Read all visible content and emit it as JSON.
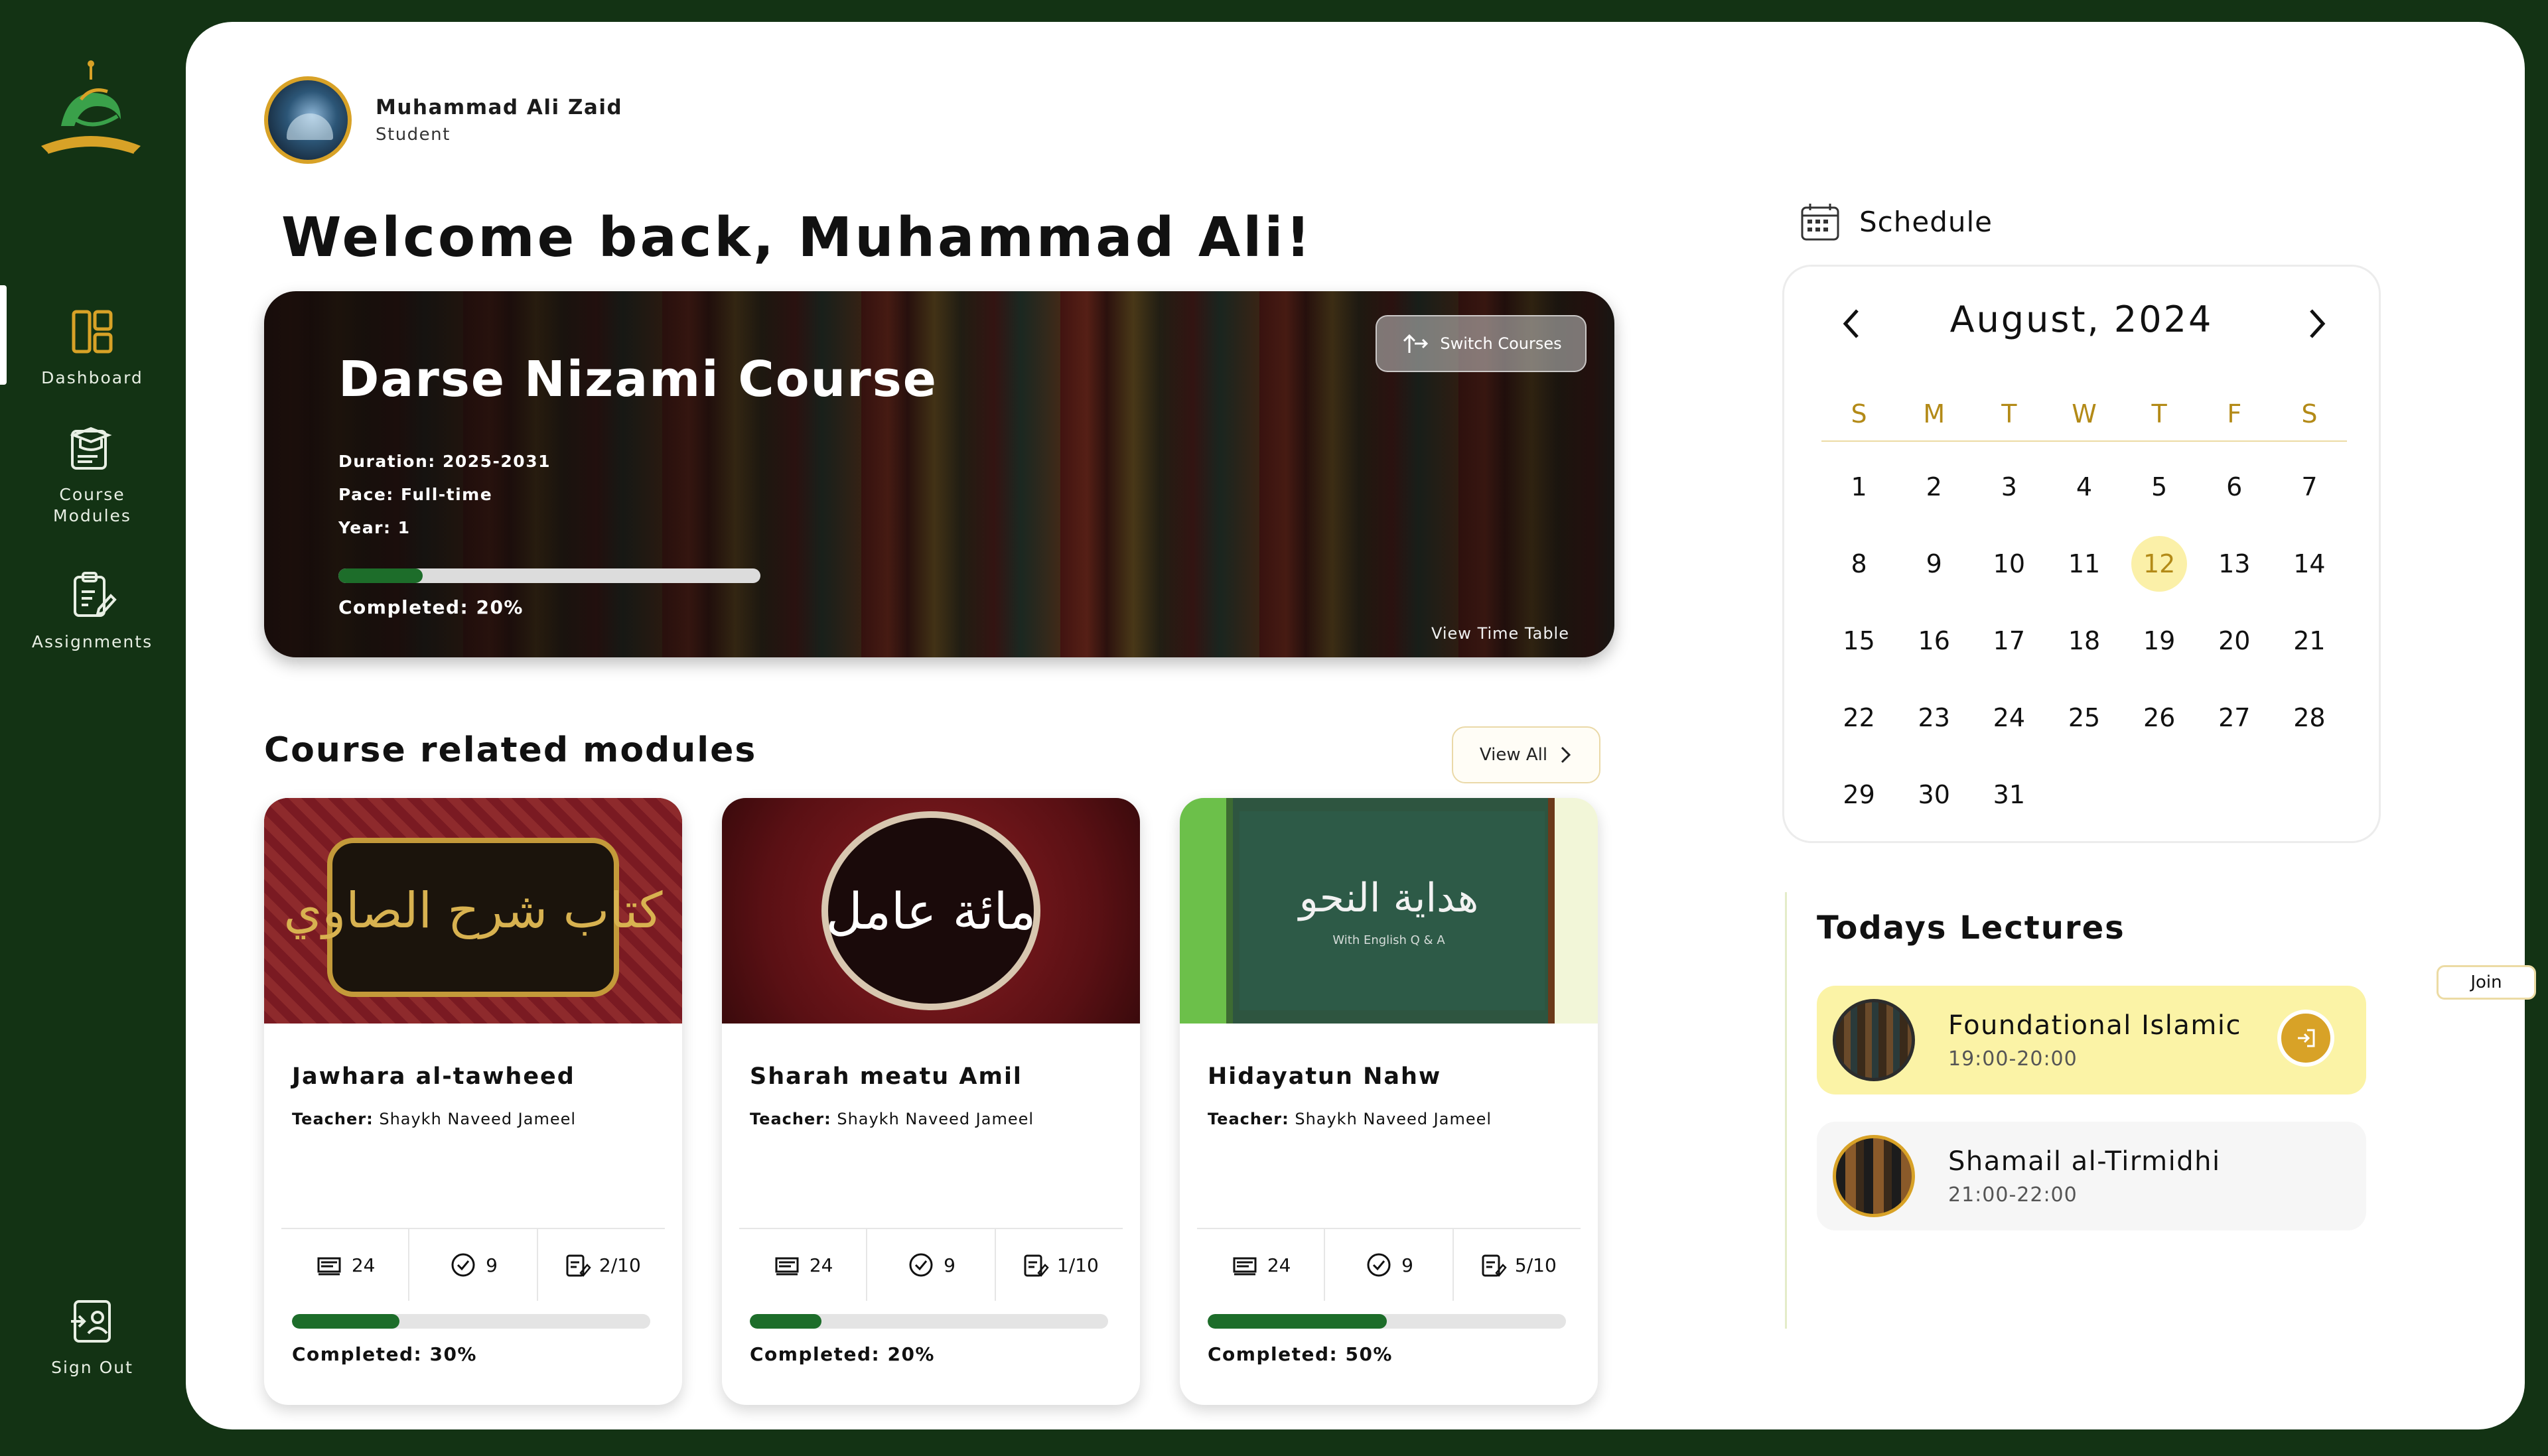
{
  "sidebar": {
    "items": [
      {
        "label": "Dashboard",
        "icon": "dashboard-icon"
      },
      {
        "label": "Course Modules",
        "icon": "course-modules-icon"
      },
      {
        "label": "Assignments",
        "icon": "assignments-icon"
      },
      {
        "label": "Sign Out",
        "icon": "sign-out-icon"
      }
    ]
  },
  "user": {
    "name": "Muhammad Ali Zaid",
    "role": "Student"
  },
  "welcome": "Welcome back, Muhammad Ali!",
  "hero": {
    "title": "Darse Nizami Course",
    "duration": "Duration: 2025-2031",
    "pace": "Pace: Full-time",
    "year": "Year: 1",
    "progress_percent": 20,
    "completed": "Completed: 20%",
    "switch_label": "Switch Courses",
    "timetable_label": "View Time Table"
  },
  "modules": {
    "title": "Course related modules",
    "view_all": "View All",
    "cards": [
      {
        "title": "Jawhara al-tawheed",
        "teacher_label": "Teacher:",
        "teacher": "Shaykh Naveed Jameel",
        "stat1": "24",
        "stat2": "9",
        "stat3": "2/10",
        "progress_percent": 30,
        "completed": "Completed: 30%"
      },
      {
        "title": "Sharah meatu Amil",
        "teacher_label": "Teacher:",
        "teacher": "Shaykh Naveed Jameel",
        "stat1": "24",
        "stat2": "9",
        "stat3": "1/10",
        "progress_percent": 20,
        "completed": "Completed: 20%"
      },
      {
        "title": "Hidayatun Nahw",
        "teacher_label": "Teacher:",
        "teacher": "Shaykh Naveed Jameel",
        "stat1": "24",
        "stat2": "9",
        "stat3": "5/10",
        "progress_percent": 50,
        "completed": "Completed: 50%"
      }
    ]
  },
  "schedule": {
    "title": "Schedule",
    "month": "August, 2024",
    "weekdays": [
      "S",
      "M",
      "T",
      "W",
      "T",
      "F",
      "S"
    ],
    "days": [
      "1",
      "2",
      "3",
      "4",
      "5",
      "6",
      "7",
      "8",
      "9",
      "10",
      "11",
      "12",
      "13",
      "14",
      "15",
      "16",
      "17",
      "18",
      "19",
      "20",
      "21",
      "22",
      "23",
      "24",
      "25",
      "26",
      "27",
      "28",
      "29",
      "30",
      "31"
    ],
    "selected_day": "12"
  },
  "lectures": {
    "title": "Todays Lectures",
    "join_label": "Join",
    "items": [
      {
        "name": "Foundational Islamic",
        "time": "19:00-20:00"
      },
      {
        "name": "Shamail al-Tirmidhi",
        "time": "21:00-22:00"
      }
    ]
  },
  "colors": {
    "sidebar_bg": "#133314",
    "accent_gold": "#d8a227",
    "progress_green": "#1d6d2a",
    "highlight_yellow": "#fbf3a6"
  }
}
